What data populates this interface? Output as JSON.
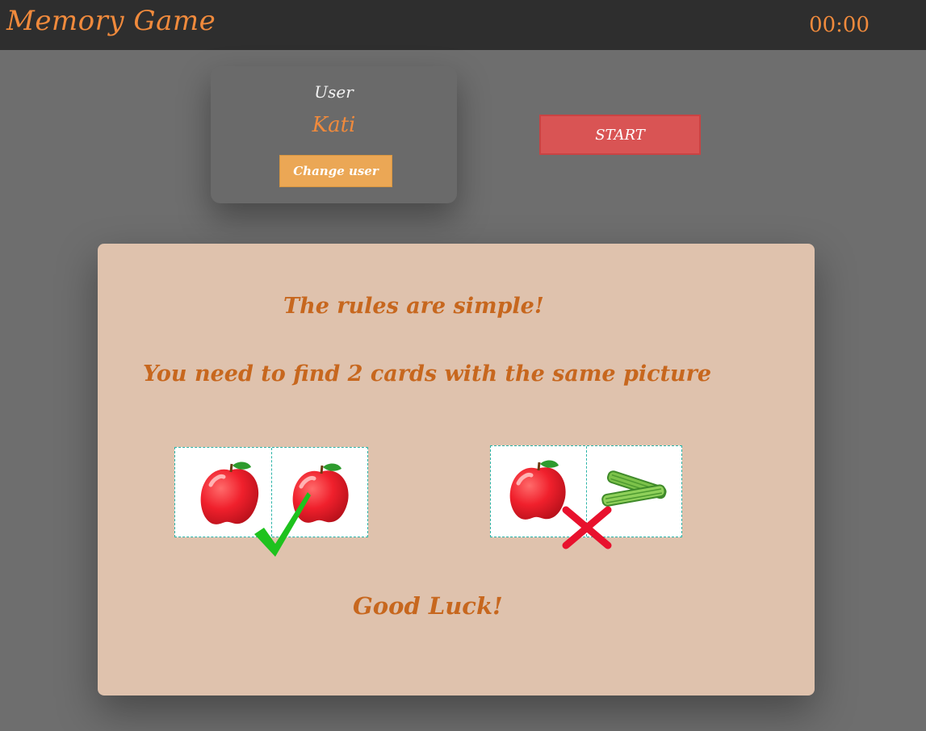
{
  "header": {
    "app_title": "Memory Game",
    "timer": "00:00"
  },
  "user_panel": {
    "label": "User",
    "name": "Kati",
    "change_button": "Change user"
  },
  "controls": {
    "start_button": "START"
  },
  "rules": {
    "line1": "The rules are simple!",
    "line2": "You need to find 2 cards with the same picture",
    "line3": "Good Luck!",
    "examples": [
      {
        "cards": [
          "apple-icon",
          "apple-icon"
        ],
        "result": "checkmark-icon"
      },
      {
        "cards": [
          "apple-icon",
          "celery-icon"
        ],
        "result": "cross-icon"
      }
    ]
  },
  "colors": {
    "accent_orange": "#f08a3c",
    "rules_text": "#c7671e",
    "start_red": "#d95454",
    "change_user_orange": "#eba755",
    "check_green": "#1ec21e",
    "cross_red": "#e8112d"
  }
}
